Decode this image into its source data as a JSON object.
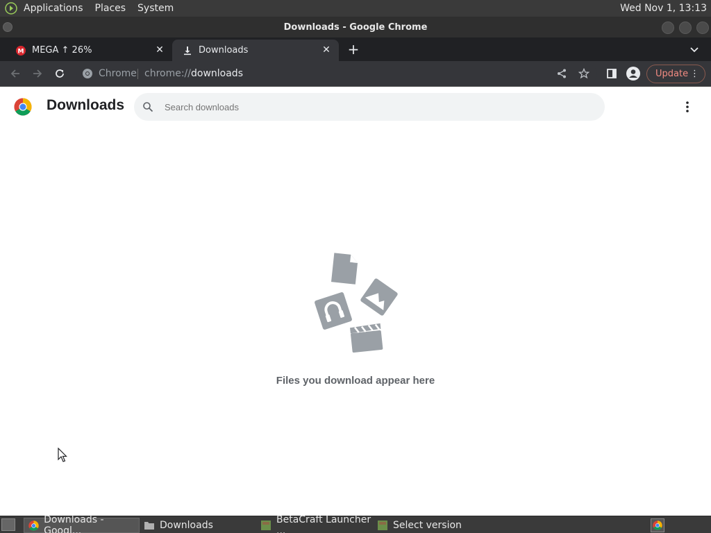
{
  "top_panel": {
    "menus": [
      "Applications",
      "Places",
      "System"
    ],
    "clock": "Wed Nov 1, 13:13"
  },
  "window": {
    "title": "Downloads - Google Chrome"
  },
  "tabs": [
    {
      "label": "MEGA ↑ 26%",
      "icon": "mega-icon"
    },
    {
      "label": "Downloads",
      "icon": "download-icon"
    }
  ],
  "toolbar": {
    "site_label": "Chrome",
    "url_scheme": "chrome://",
    "url_host": "downloads",
    "update_label": "Update"
  },
  "page": {
    "title": "Downloads",
    "search_placeholder": "Search downloads",
    "empty_message": "Files you download appear here"
  },
  "taskbar": {
    "items": [
      {
        "label": "Downloads - Googl...",
        "icon": "chrome-icon"
      },
      {
        "label": "Downloads",
        "icon": "folder-icon"
      },
      {
        "label": "BetaCraft Launcher ...",
        "icon": "betacraft-icon"
      },
      {
        "label": "Select version",
        "icon": "betacraft-icon"
      }
    ]
  },
  "colors": {
    "tab_strip": "#202124",
    "toolbar": "#35363a",
    "update_accent": "#f28b82",
    "empty_art": "#9aa0a6"
  }
}
